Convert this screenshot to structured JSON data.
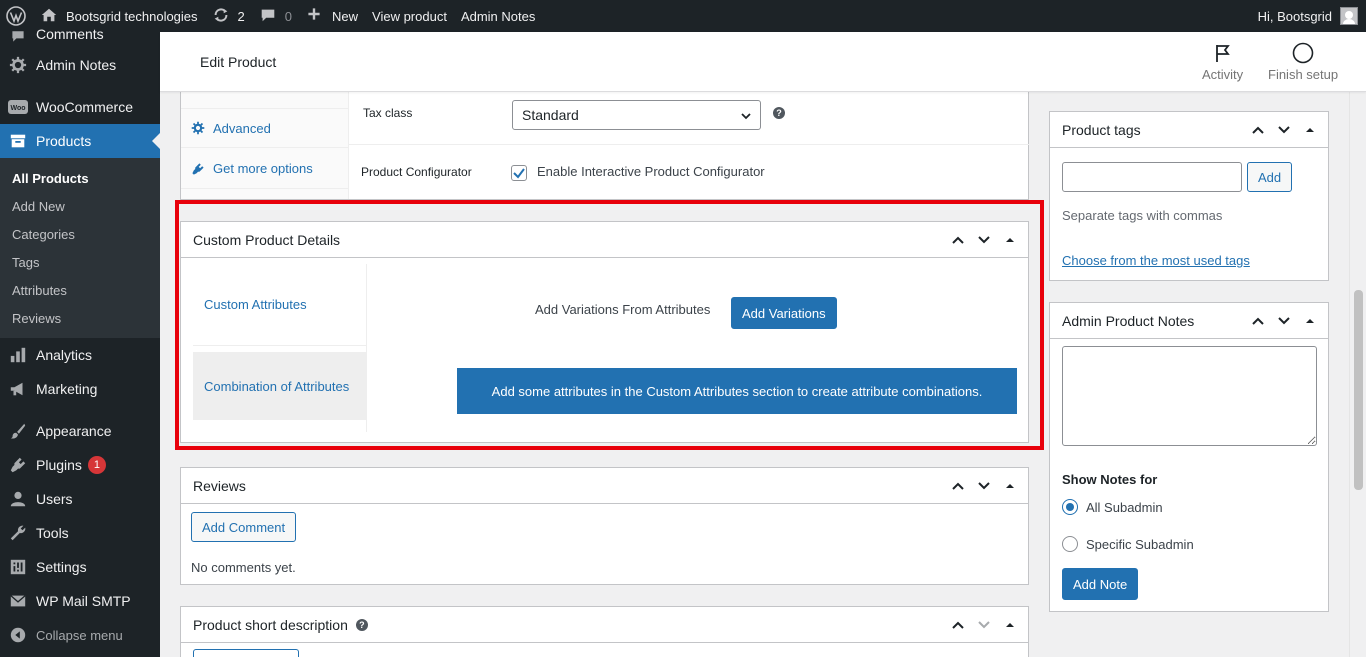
{
  "adminbar": {
    "site_name": "Bootsgrid technologies",
    "updates_count": "2",
    "comments_count": "0",
    "new_label": "New",
    "view_product": "View product",
    "admin_notes": "Admin Notes",
    "greeting": "Hi, Bootsgrid"
  },
  "sidebar": {
    "top_items": [
      "Comments",
      "Admin Notes"
    ],
    "woocommerce": "WooCommerce",
    "products": "Products",
    "submenu": [
      "All Products",
      "Add New",
      "Categories",
      "Tags",
      "Attributes",
      "Reviews"
    ],
    "analytics": "Analytics",
    "marketing": "Marketing",
    "appearance": "Appearance",
    "plugins": "Plugins",
    "plugins_badge": "1",
    "users": "Users",
    "tools": "Tools",
    "settings": "Settings",
    "wp_mail_smtp": "WP Mail SMTP",
    "collapse": "Collapse menu"
  },
  "header": {
    "title": "Edit Product",
    "activity": "Activity",
    "finish_setup": "Finish setup"
  },
  "product_data": {
    "tabs": [
      "Advanced",
      "Get more options"
    ],
    "tax_class_label": "Tax class",
    "tax_class_value": "Standard",
    "configurator_label": "Product Configurator",
    "configurator_checkbox": "Enable Interactive Product Configurator"
  },
  "custom_details": {
    "title": "Custom Product Details",
    "tabs": [
      "Custom Attributes",
      "Combination of Attributes"
    ],
    "variations_label": "Add Variations From Attributes",
    "variations_button": "Add Variations",
    "notice": "Add some attributes in the Custom Attributes section to create attribute combinations."
  },
  "reviews": {
    "title": "Reviews",
    "add_comment": "Add Comment",
    "empty": "No comments yet."
  },
  "short_description": {
    "title": "Product short description"
  },
  "product_tags": {
    "title": "Product tags",
    "add_button": "Add",
    "hint": "Separate tags with commas",
    "choose_link": "Choose from the most used tags"
  },
  "admin_notes_box": {
    "title": "Admin Product Notes",
    "show_for": "Show Notes for",
    "options": [
      "All Subadmin",
      "Specific Subadmin"
    ],
    "add_note": "Add Note"
  },
  "colors": {
    "primary": "#2271b1",
    "highlight_border": "#e8000b",
    "admin_dark": "#1d2327"
  }
}
